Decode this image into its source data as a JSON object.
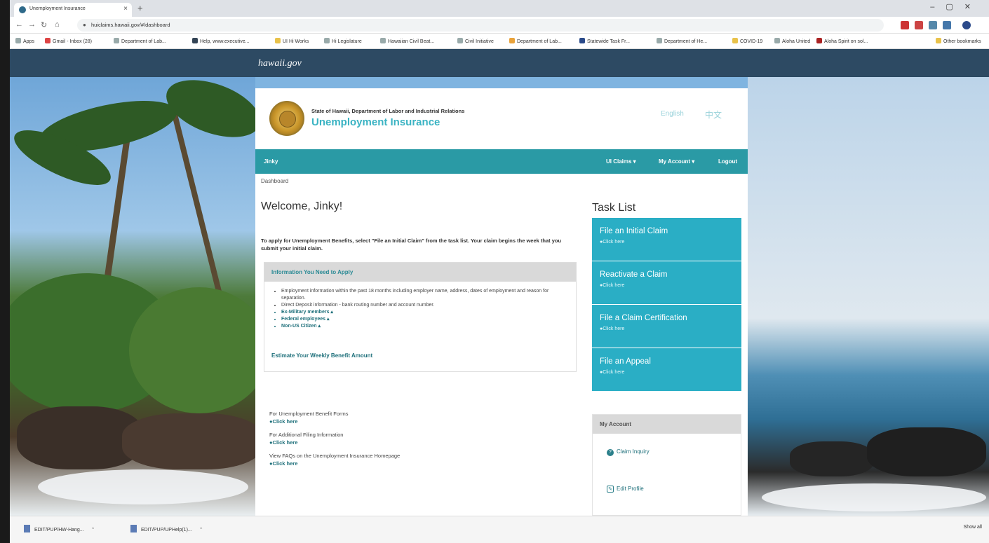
{
  "browser": {
    "tab_title": "Unemployment Insurance",
    "url": "huiclaims.hawaii.gov/#/dashboard",
    "bookmarks": [
      "Apps",
      "Gmail - Inbox (28)",
      "Department of Lab...",
      "Help, www.executive...",
      "UI Hi Works",
      "Hi Legislature",
      "Hawaiian Civil Beat...",
      "Civil Initiative",
      "Department of Lab...",
      "Statewide Task Fr...",
      "Department of He...",
      "COVID-19",
      "Aloha United",
      "Aloha Spirit on sol...",
      "Other bookmarks"
    ]
  },
  "site": {
    "gov_logo": "hawaii.gov",
    "org_line": "State of Hawaii, Department of Labor and Industrial Relations",
    "title": "Unemployment Insurance",
    "lang_english": "English",
    "lang_chinese": "中文"
  },
  "nav": {
    "user": "Jinky",
    "ui_claims": "UI Claims ▾",
    "my_account": "My Account ▾",
    "logout": "Logout"
  },
  "breadcrumb": "Dashboard",
  "welcome": "Welcome, Jinky!",
  "intro": "To apply for Unemployment Benefits, select \"File an Initial Claim\" from the task list. Your claim begins the week that you submit your initial claim.",
  "info": {
    "heading": "Information You Need to Apply",
    "items": [
      "Employment information within the past 18 months including employer name, address, dates of employment and reason for separation.",
      "Direct Deposit information - bank routing number and account number.",
      "Ex-Military members ▴",
      "Federal employees ▴",
      "Non-US Citizen ▴"
    ],
    "estimate": "Estimate Your Weekly Benefit Amount"
  },
  "forms": [
    {
      "label": "For Unemployment Benefit Forms",
      "link": "Click here"
    },
    {
      "label": "For Additional Filing Information",
      "link": "Click here"
    },
    {
      "label": "View FAQs on the Unemployment Insurance Homepage",
      "link": "Click here"
    }
  ],
  "task_list": {
    "title": "Task List",
    "items": [
      {
        "label": "File an Initial Claim",
        "sub": "Click here"
      },
      {
        "label": "Reactivate a Claim",
        "sub": "Click here"
      },
      {
        "label": "File a Claim Certification",
        "sub": "Click here"
      },
      {
        "label": "File an Appeal",
        "sub": "Click here"
      }
    ]
  },
  "my_account": {
    "heading": "My Account",
    "claim_inquiry": "Claim Inquiry",
    "edit_profile": "Edit Profile"
  },
  "downloads": {
    "file1": "EDIT/PUP/HW-Hang...",
    "file2": "EDIT/PUP/UPHelp(1)...",
    "show_all": "Show all"
  },
  "colors": {
    "teal": "#2a9aa5",
    "task_blue": "#2aaec5",
    "gov_bar": "#2d4a63"
  }
}
